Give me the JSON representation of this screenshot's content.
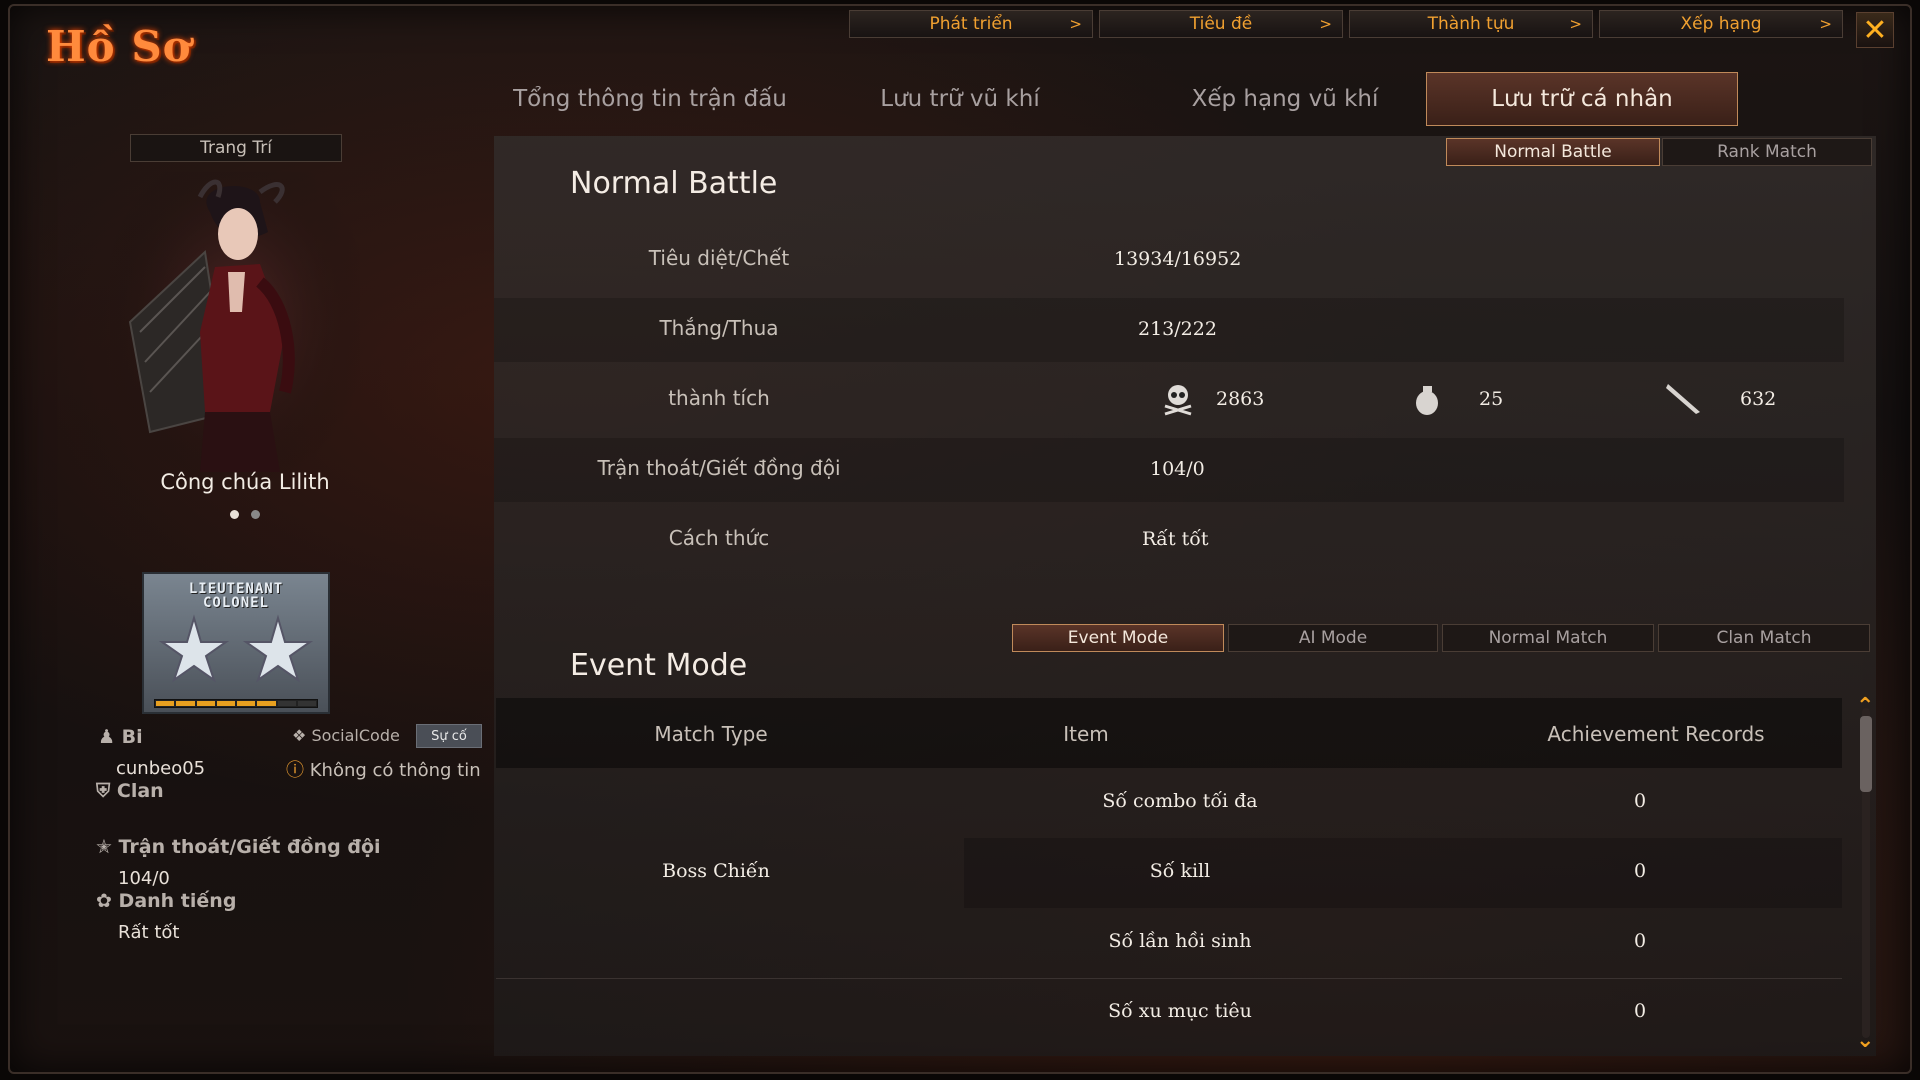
{
  "header": {
    "title": "Hồ Sơ",
    "top_tabs": [
      "Phát triển",
      "Tiêu đề",
      "Thành tựu",
      "Xếp hạng"
    ],
    "chevron": ">",
    "close": "✕"
  },
  "main_tabs": [
    "Tổng thông tin trận đấu",
    "Lưu trữ vũ khí",
    "Xếp hạng vũ khí",
    "Lưu trữ cá nhân"
  ],
  "left": {
    "decor_label": "Trang Trí",
    "character_name": "Công chúa Lilith",
    "rank_line1": "LIEUTENANT",
    "rank_line2": "COLONEL",
    "rank_progress": 0.75,
    "name_label": "Bi",
    "username": "cunbeo05",
    "social_label": "SocialCode",
    "social_button": "Sự cố",
    "social_value": "Không có thông tin",
    "clan_label": "Clan",
    "desert_label": "Trận thoát/Giết đồng đội",
    "desert_value": "104/0",
    "reputation_label": "Danh tiếng",
    "reputation_value": "Rất tốt"
  },
  "normal": {
    "title": "Normal Battle",
    "mode_buttons": [
      "Normal Battle",
      "Rank Match"
    ],
    "rows": [
      {
        "label": "Tiêu diệt/Chết",
        "value": "13934/16952"
      },
      {
        "label": "Thắng/Thua",
        "value": "213/222"
      },
      {
        "label": "thành tích",
        "value": ""
      },
      {
        "label": "Trận thoát/Giết đồng đội",
        "value": "104/0"
      },
      {
        "label": "Cách thức",
        "value": "Rất tốt"
      }
    ],
    "achievements": {
      "skull": "2863",
      "grenade": "25",
      "knife": "632"
    }
  },
  "event": {
    "title": "Event Mode",
    "mode_buttons": [
      "Event Mode",
      "AI Mode",
      "Normal Match",
      "Clan Match"
    ],
    "headers": [
      "Match Type",
      "Item",
      "Achievement Records"
    ],
    "group": "Boss Chiến",
    "rows": [
      {
        "item": "Số combo tối đa",
        "value": "0"
      },
      {
        "item": "Số kill",
        "value": "0"
      },
      {
        "item": "Số lần hồi sinh",
        "value": "0"
      },
      {
        "item": "Số xu mục tiêu",
        "value": "0"
      }
    ]
  },
  "colors": {
    "accent": "#f0a030",
    "title": "#ff8a3c",
    "active_tab": "#5a3428"
  }
}
